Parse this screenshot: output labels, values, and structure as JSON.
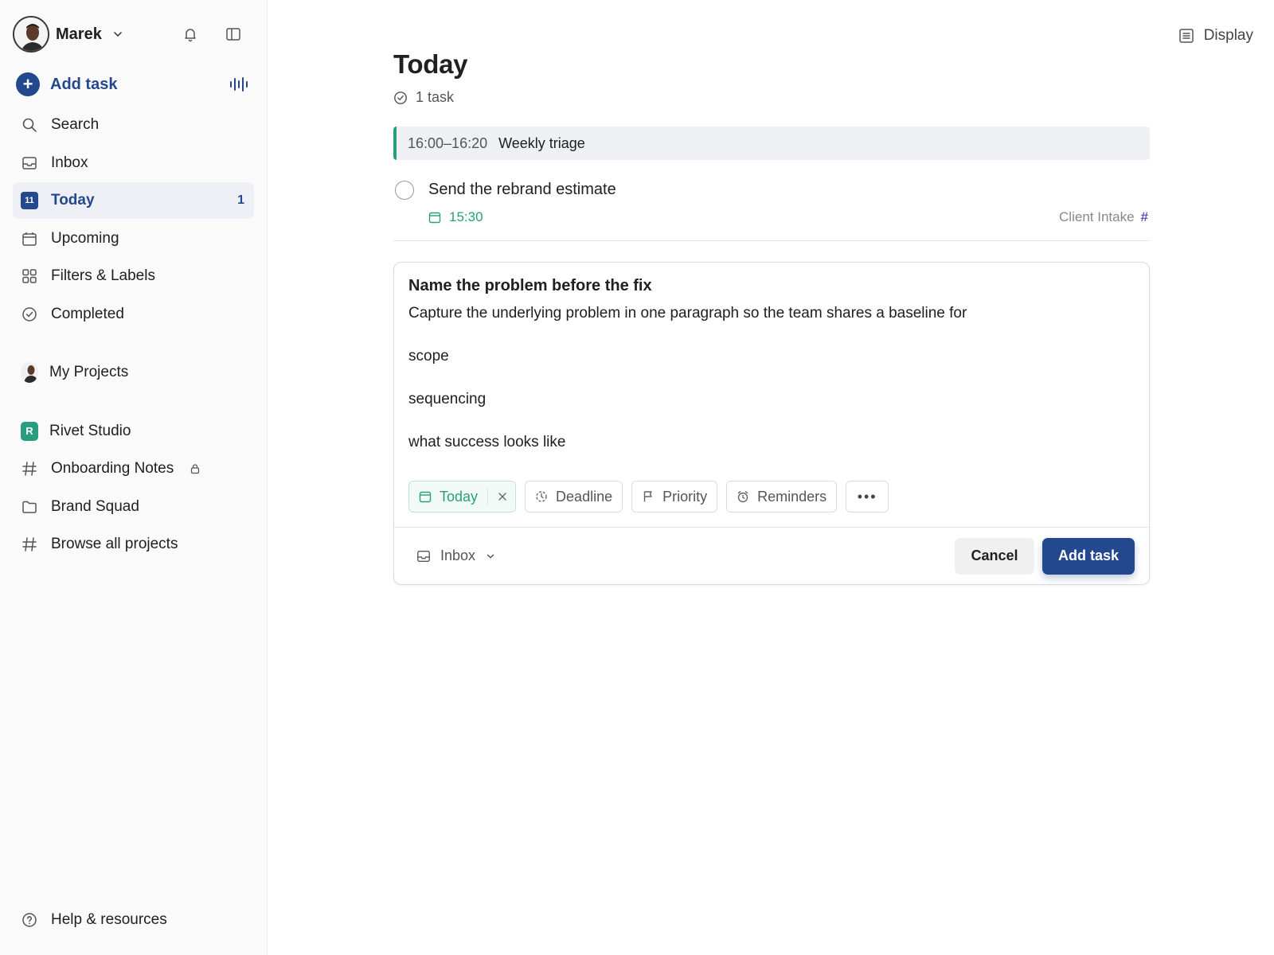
{
  "user": {
    "name": "Marek"
  },
  "sidebar": {
    "add_task": "Add task",
    "nav": [
      {
        "label": "Search",
        "icon": "search-icon"
      },
      {
        "label": "Inbox",
        "icon": "inbox-icon"
      },
      {
        "label": "Today",
        "icon": "calendar-today-icon",
        "badge": "11",
        "count": "1",
        "active": true
      },
      {
        "label": "Upcoming",
        "icon": "calendar-icon"
      },
      {
        "label": "Filters & Labels",
        "icon": "grid-icon"
      },
      {
        "label": "Completed",
        "icon": "check-circle-icon"
      }
    ],
    "my_projects": "My Projects",
    "workspace": {
      "badge": "R",
      "name": "Rivet Studio"
    },
    "projects": [
      {
        "label": "Onboarding Notes",
        "icon": "hash-icon",
        "locked": true
      },
      {
        "label": "Brand Squad",
        "icon": "folder-icon"
      },
      {
        "label": "Browse all projects",
        "icon": "hash-icon"
      }
    ],
    "help": "Help & resources"
  },
  "header": {
    "display": "Display"
  },
  "main": {
    "title": "Today",
    "task_count": "1 task",
    "event": {
      "time": "16:00–16:20",
      "title": "Weekly triage"
    },
    "task": {
      "title": "Send the rebrand estimate",
      "due": "15:30",
      "project": "Client Intake",
      "project_symbol": "#"
    }
  },
  "editor": {
    "title": "Name the problem before the fix",
    "body": [
      "Capture the underlying problem in one paragraph so the team shares a baseline for",
      "scope",
      "sequencing",
      "what success looks like"
    ],
    "chips": {
      "today": "Today",
      "deadline": "Deadline",
      "priority": "Priority",
      "reminders": "Reminders",
      "more": "•••"
    },
    "project": "Inbox",
    "cancel": "Cancel",
    "add": "Add task"
  },
  "colors": {
    "accent": "#24488e",
    "green": "#2a9d7f",
    "purple": "#6b4fbb"
  }
}
